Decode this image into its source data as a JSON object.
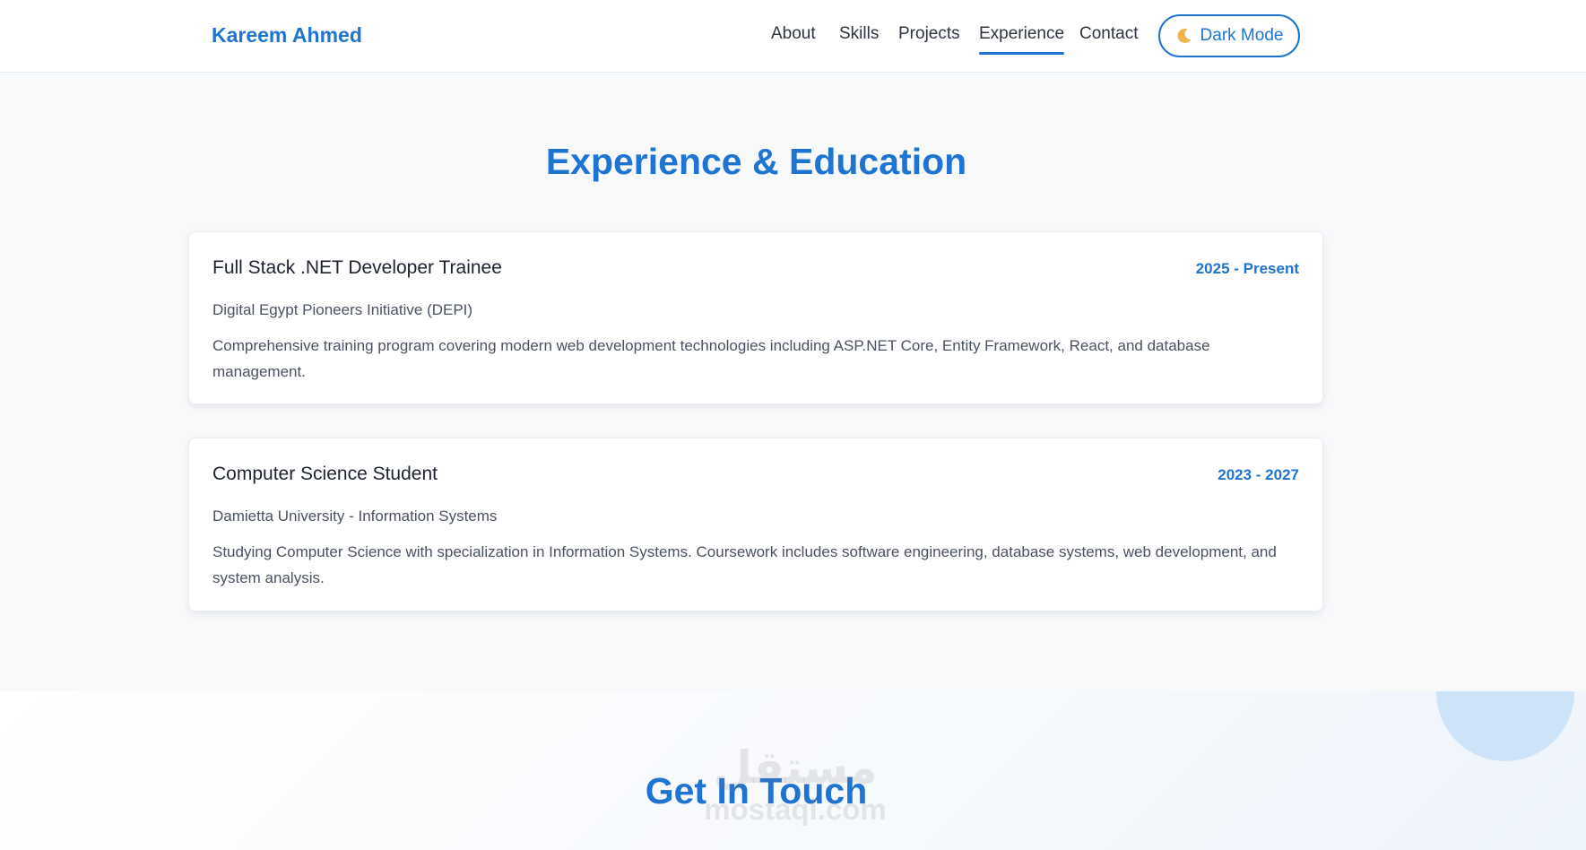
{
  "brand": {
    "name": "Kareem Ahmed"
  },
  "nav": {
    "items": [
      {
        "label": "About"
      },
      {
        "label": "Skills"
      },
      {
        "label": "Projects"
      },
      {
        "label": "Experience"
      },
      {
        "label": "Contact"
      }
    ],
    "active": "Experience"
  },
  "mode_toggle": {
    "label": "Dark Mode",
    "icon": "moon-icon"
  },
  "experience": {
    "title": "Experience & Education",
    "cards": [
      {
        "title": "Full Stack .NET Developer Trainee",
        "date": "2025 - Present",
        "org": "Digital Egypt Pioneers Initiative (DEPI)",
        "description": "Comprehensive training program covering modern web development technologies including ASP.NET Core, Entity Framework, React, and database management."
      },
      {
        "title": "Computer Science Student",
        "date": "2023 - 2027",
        "org": "Damietta University - Information Systems",
        "description": "Studying Computer Science with specialization in Information Systems. Coursework includes software engineering, database systems, web development, and system analysis."
      }
    ]
  },
  "contact": {
    "title": "Get In Touch"
  },
  "watermark": {
    "arabic": "مستقل",
    "latin": "mostaql.com"
  },
  "colors": {
    "accent": "#1f74d1",
    "background": "#f8f9fb",
    "card": "#ffffff",
    "deco_circle": "#cde4f8"
  }
}
